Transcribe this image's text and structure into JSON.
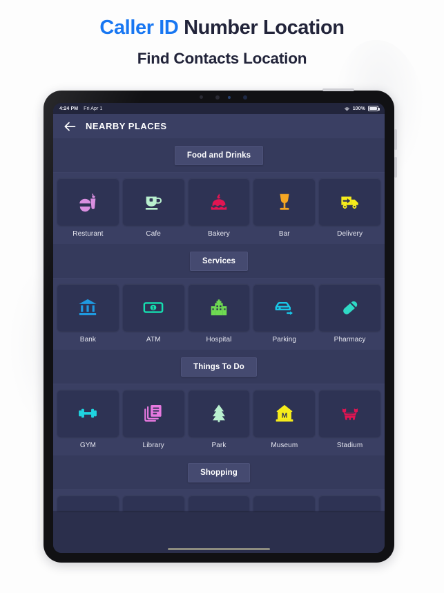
{
  "promo": {
    "title_accent": "Caller ID",
    "title_rest": " Number Location",
    "subtitle": "Find Contacts Location",
    "accent_color": "#1877f2",
    "text_color": "#22243a"
  },
  "device": {
    "status_bar": {
      "time": "4:24 PM",
      "date": "Fri Apr 1",
      "wifi_icon": "wifi-icon",
      "battery_percent": "100%",
      "battery_icon": "battery-full-icon"
    },
    "app_bar": {
      "back_icon": "arrow-left-icon",
      "title": "NEARBY PLACES"
    }
  },
  "sections": [
    {
      "id": "food-and-drinks",
      "title": "Food and Drinks",
      "truncated": false,
      "tiles": [
        {
          "label": "Resturant",
          "icon": "burger-drink-icon",
          "color": "#d98fe0"
        },
        {
          "label": "Cafe",
          "icon": "coffee-cup-icon",
          "color": "#b9f0cf"
        },
        {
          "label": "Bakery",
          "icon": "cake-icon",
          "color": "#e11552"
        },
        {
          "label": "Bar",
          "icon": "wine-glass-icon",
          "color": "#f5a623"
        },
        {
          "label": "Delivery",
          "icon": "delivery-truck-icon",
          "color": "#f6ec1b"
        }
      ]
    },
    {
      "id": "services",
      "title": "Services",
      "truncated": false,
      "tiles": [
        {
          "label": "Bank",
          "icon": "bank-icon",
          "color": "#1f9ae0"
        },
        {
          "label": "ATM",
          "icon": "banknote-icon",
          "color": "#15e0b0"
        },
        {
          "label": "Hospital",
          "icon": "hospital-icon",
          "color": "#6fdb52"
        },
        {
          "label": "Parking",
          "icon": "car-icon",
          "color": "#19c7e8"
        },
        {
          "label": "Pharmacy",
          "icon": "pill-icon",
          "color": "#2fd9c5"
        }
      ]
    },
    {
      "id": "things-to-do",
      "title": "Things To Do",
      "truncated": false,
      "tiles": [
        {
          "label": "GYM",
          "icon": "dumbbell-icon",
          "color": "#1fd4e0"
        },
        {
          "label": "Library",
          "icon": "books-icon",
          "color": "#e879e0"
        },
        {
          "label": "Park",
          "icon": "tree-icon",
          "color": "#b9f0cf"
        },
        {
          "label": "Museum",
          "icon": "museum-icon",
          "color": "#f6ec1b"
        },
        {
          "label": "Stadium",
          "icon": "stadium-icon",
          "color": "#e11552"
        }
      ]
    },
    {
      "id": "shopping",
      "title": "Shopping",
      "truncated": true,
      "tiles": [
        {
          "label": "",
          "icon": "",
          "color": ""
        },
        {
          "label": "",
          "icon": "",
          "color": ""
        },
        {
          "label": "",
          "icon": "",
          "color": ""
        },
        {
          "label": "",
          "icon": "",
          "color": ""
        },
        {
          "label": "",
          "icon": "",
          "color": ""
        }
      ]
    }
  ]
}
